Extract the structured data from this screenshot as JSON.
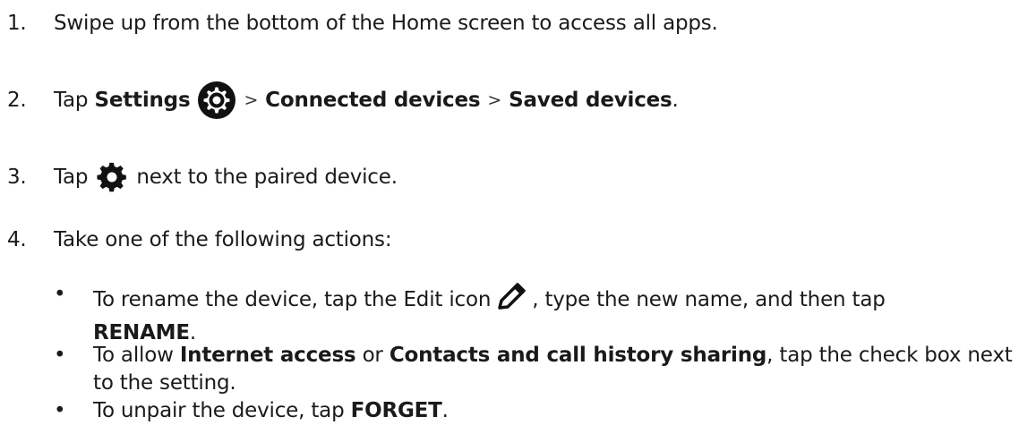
{
  "steps": {
    "s1": {
      "num": "1.",
      "text": "Swipe up from the bottom of the Home screen to access all apps."
    },
    "s2": {
      "num": "2.",
      "tap": "Tap",
      "settings": "Settings",
      "sep1": ">",
      "connected": "Connected devices",
      "sep2": ">",
      "saved": "Saved devices",
      "end": "."
    },
    "s3": {
      "num": "3.",
      "tap": "Tap",
      "rest": "next to the paired device."
    },
    "s4": {
      "num": "4.",
      "text": "Take one of the following actions:"
    }
  },
  "bullets": {
    "b1": {
      "dot": "•",
      "pre": "To rename the device, tap the Edit icon",
      "post": ", type the new name, and then tap",
      "bold": "RENAME",
      "end": "."
    },
    "b2": {
      "dot": "•",
      "pre": "To allow",
      "bold1": "Internet access",
      "mid": "or",
      "bold2": "Contacts and call history sharing",
      "post": ", tap the check box next to the setting."
    },
    "b3": {
      "dot": "•",
      "pre": "To unpair the device, tap",
      "bold": "FORGET",
      "end": "."
    }
  },
  "icons": {
    "settings_app": "settings-app-icon",
    "gear": "gear-icon",
    "edit": "pencil-edit-icon"
  },
  "colors": {
    "text": "#1a1a1a",
    "icon": "#111111"
  }
}
